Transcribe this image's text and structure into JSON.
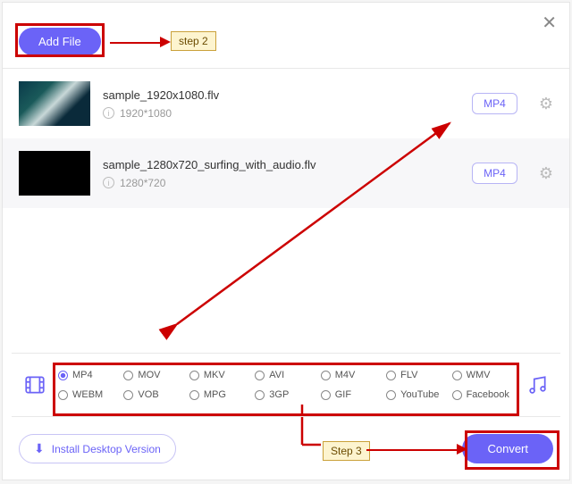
{
  "header": {
    "add_file_label": "Add File"
  },
  "annotations": {
    "step2": "step 2",
    "step3": "Step 3"
  },
  "files": [
    {
      "name": "sample_1920x1080.flv",
      "resolution": "1920*1080",
      "format": "MP4"
    },
    {
      "name": "sample_1280x720_surfing_with_audio.flv",
      "resolution": "1280*720",
      "format": "MP4"
    }
  ],
  "format_options": {
    "selected": "MP4",
    "row1": [
      "MP4",
      "MOV",
      "MKV",
      "AVI",
      "M4V",
      "FLV",
      "WMV"
    ],
    "row2": [
      "WEBM",
      "VOB",
      "MPG",
      "3GP",
      "GIF",
      "YouTube",
      "Facebook"
    ]
  },
  "footer": {
    "install_label": "Install Desktop Version",
    "convert_label": "Convert"
  }
}
